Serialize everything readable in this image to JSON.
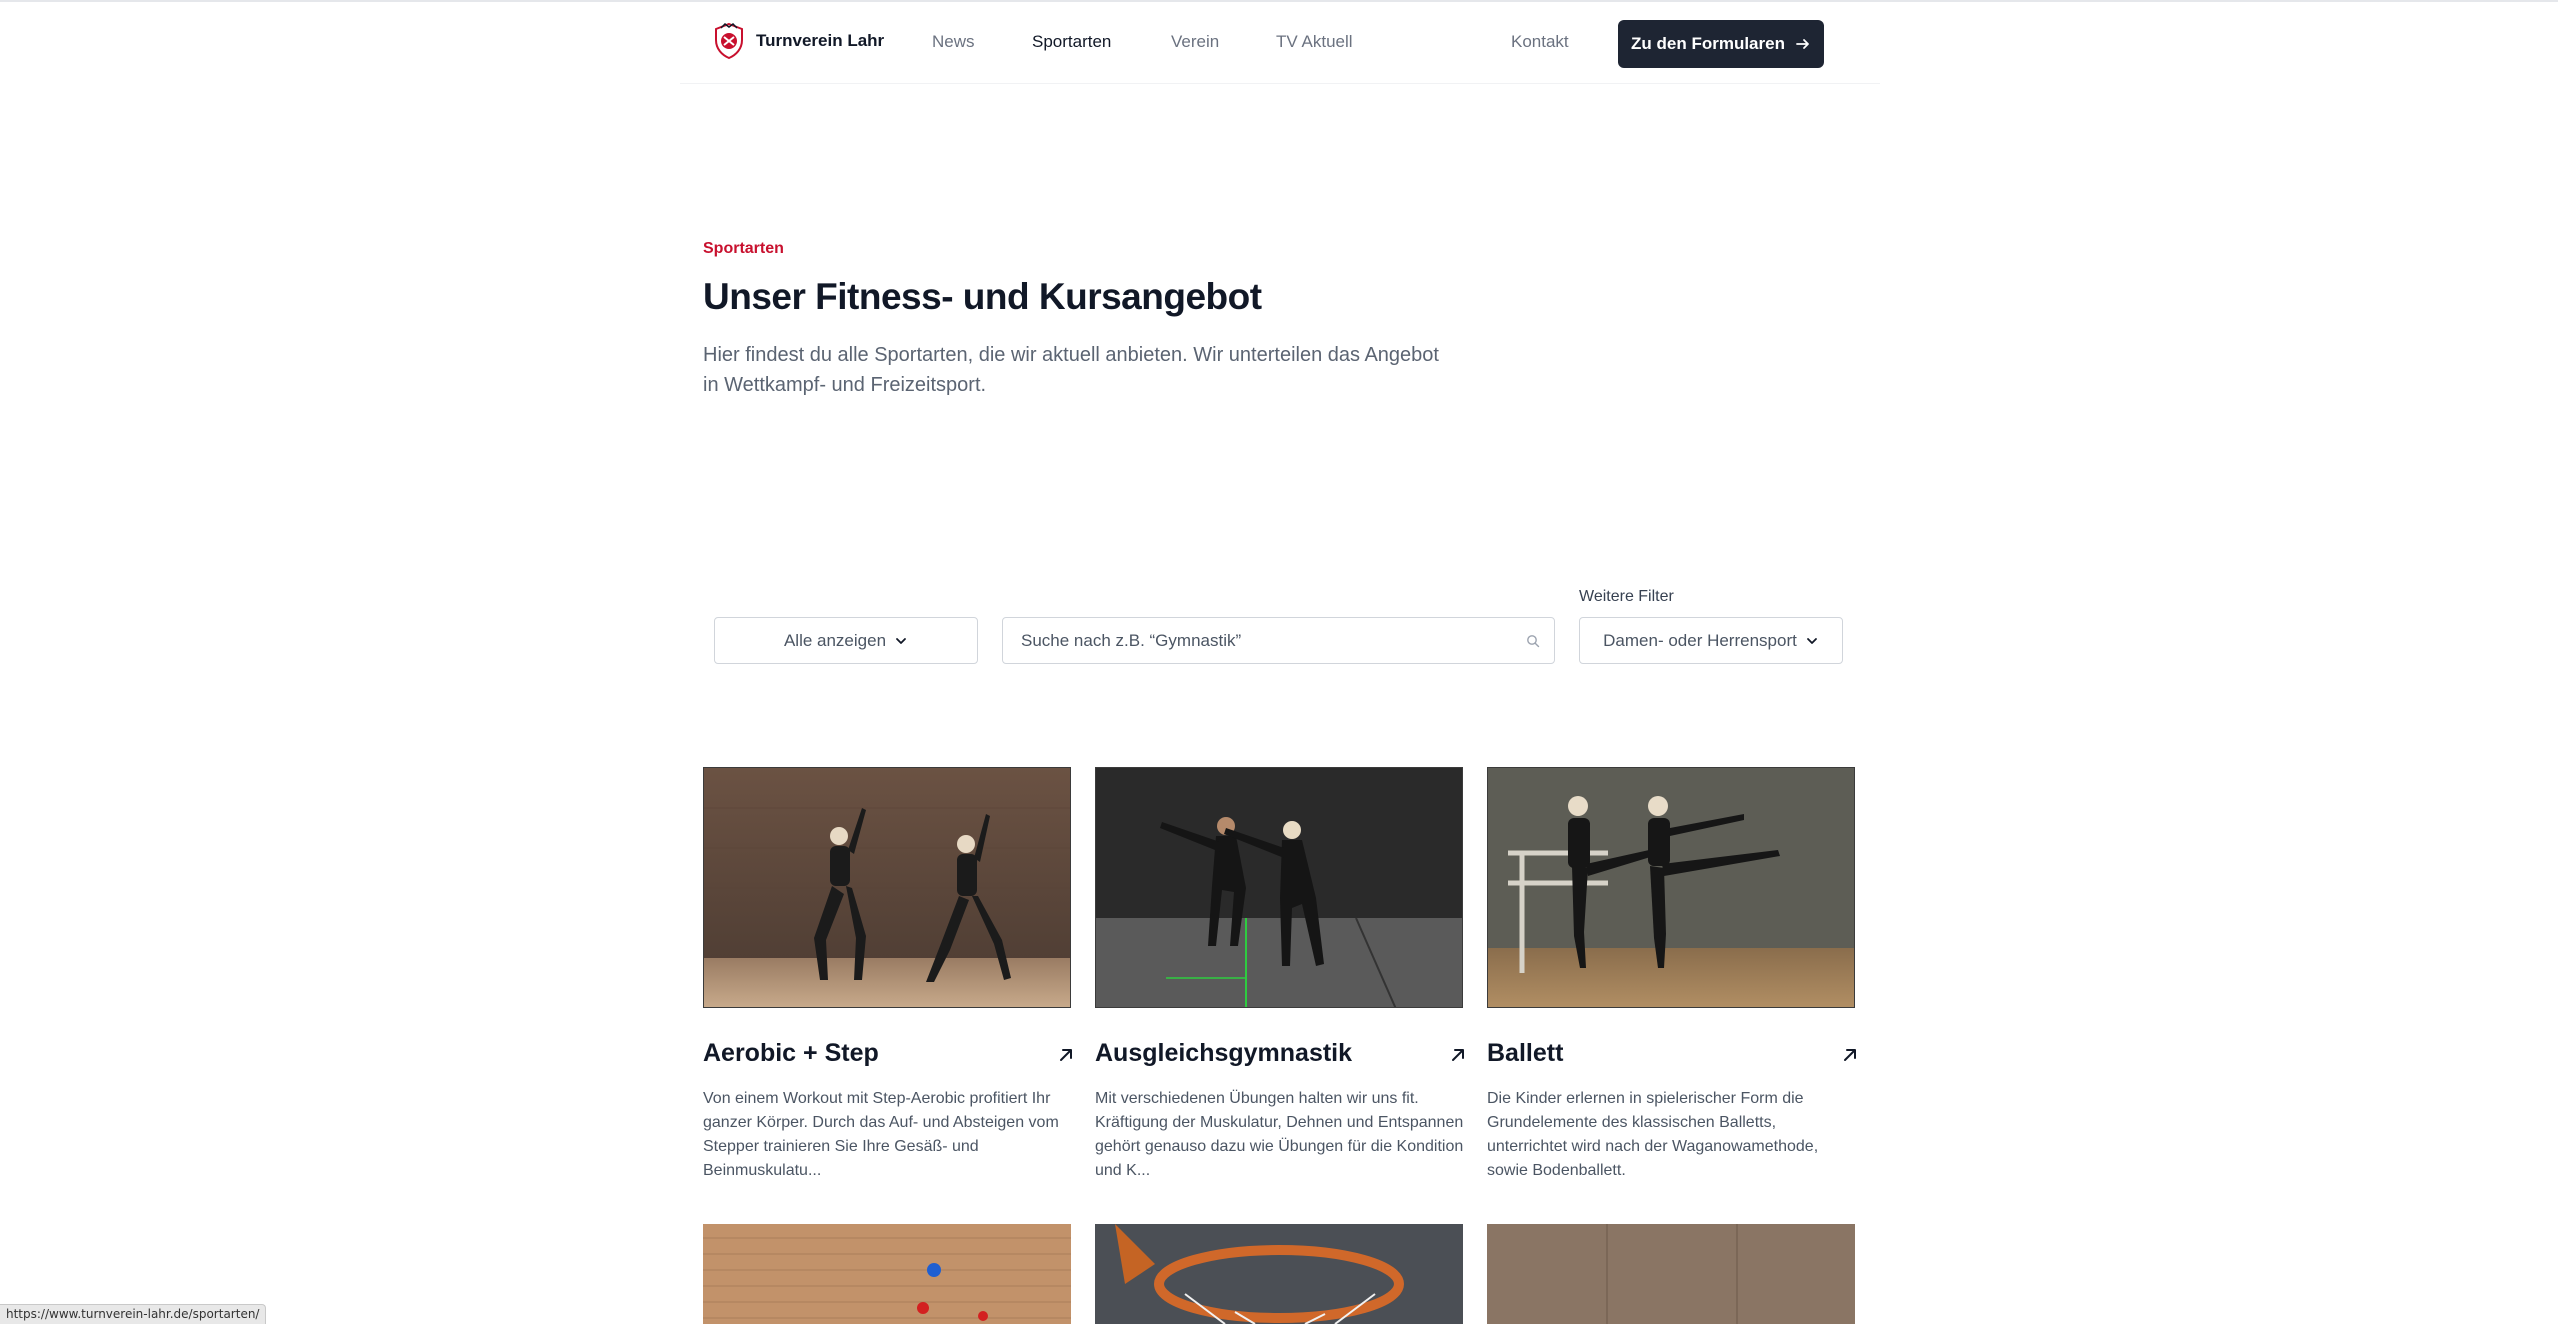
{
  "header": {
    "logo_text": "Turnverein Lahr",
    "nav": [
      "News",
      "Sportarten",
      "Verein",
      "TV Aktuell"
    ],
    "contact": "Kontakt",
    "cta_label": "Zu den Formularen"
  },
  "hero": {
    "eyebrow": "Sportarten",
    "title": "Unser Fitness- und Kursangebot",
    "lead": "Hier findest du alle Sportarten, die wir aktuell anbieten. Wir unterteilen das Angebot in Wettkampf- und Freizeitsport."
  },
  "filters": {
    "category_value": "Alle anzeigen",
    "search_placeholder": "Suche nach z.B. “Gymnastik”",
    "more_label": "Weitere Filter",
    "gender_value": "Damen- oder Herrensport"
  },
  "cards": [
    {
      "title": "Aerobic + Step",
      "desc": "Von einem Workout mit Step-Aerobic profitiert Ihr ganzer Körper. Durch das Auf- und Absteigen vom Stepper trainieren Sie Ihre Gesäß- und Beinmuskulatu..."
    },
    {
      "title": "Ausgleichsgymnastik",
      "desc": "Mit verschiedenen Übungen halten wir uns fit. Kräftigung der Muskulatur, Dehnen und Entspannen gehört genauso dazu wie Übungen für die Kondition und K..."
    },
    {
      "title": "Ballett",
      "desc": "Die Kinder erlernen in spielerischer Form die Grundelemente des klassischen Balletts, unterrichtet wird nach der Waganowamethode, sowie Bodenballett."
    }
  ],
  "status_url": "https://www.turnverein-lahr.de/sportarten/",
  "colors": {
    "accent": "#c8102e",
    "cta_bg": "#1e2533",
    "text": "#111827",
    "muted": "#4b5563"
  },
  "icons": [
    "club-crest-icon",
    "arrow-right-icon",
    "chevron-down-icon",
    "search-icon",
    "arrow-up-right-icon"
  ]
}
